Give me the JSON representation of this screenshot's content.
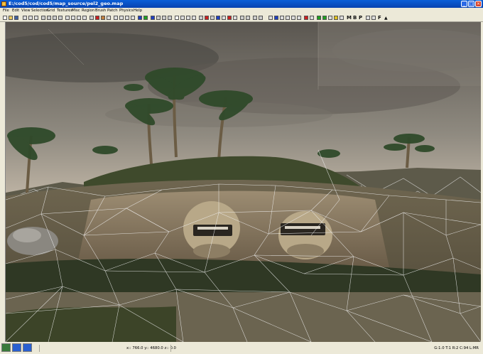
{
  "window": {
    "title": "E:/cod5/cod/cod5/map_source/pel2_geo.map",
    "buttons": {
      "minimize": "_",
      "maximize": "□",
      "close": "×"
    }
  },
  "menu": [
    "File",
    "Edit",
    "View",
    "Selection",
    "Grid",
    "Textures",
    "Misc",
    "Region",
    "Brush",
    "Patch",
    "Physics",
    "Help"
  ],
  "toolbar": {
    "letters": [
      "M",
      "B",
      "P"
    ],
    "flag_label": "F",
    "colors": {
      "red": "#cc2020",
      "green": "#20a020",
      "blue": "#2040c0",
      "yellow": "#e0c020"
    }
  },
  "statusbar": {
    "coords": "x:: 766.0  y:: 4680.0  z:: 0.0",
    "right": "G:1.0  T:1  R:2  C:94  L:MR"
  }
}
